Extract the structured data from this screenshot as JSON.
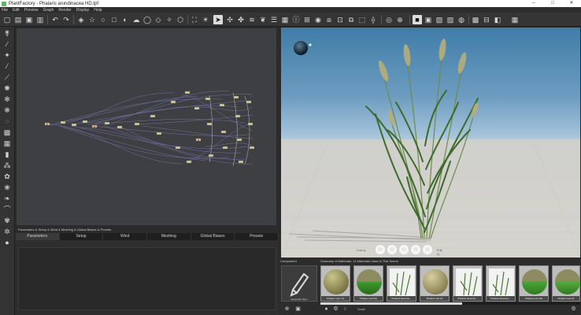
{
  "window": {
    "title": "PlantFactory - Phalaris arundinacea HD.tpf",
    "controls": [
      "─",
      "□",
      "✕"
    ]
  },
  "menu": [
    "File",
    "Edit",
    "Preview",
    "Graph",
    "Render",
    "Display",
    "Help"
  ],
  "toolbar_icons": [
    "new-file-icon",
    "open-file-icon",
    "save-icon",
    "save-as-icon",
    "undo-icon",
    "redo-icon",
    "cube-icon",
    "star-icon",
    "sphere-icon",
    "square-icon",
    "light-icon",
    "cloud-icon",
    "fit-view-icon",
    "sun-icon",
    "select-arrow-icon",
    "node-icon",
    "branch-icon",
    "wind-icon",
    "leaf-icon",
    "info-icon",
    "grid-icon",
    "camera-icon",
    "hide-icon",
    "view-front-icon",
    "render-icon",
    "color-icon",
    "preview-icon",
    "material-icon",
    "chart-icon",
    "palette-icon",
    "grid-layout-icon",
    "window-icon"
  ],
  "left_tool_icons": [
    "tree-icon",
    "stem-icon",
    "leaves-icon",
    "grass-icon",
    "branch-tool-icon",
    "fern-icon",
    "root-icon",
    "flower-icon",
    "sphere-tool-icon",
    "texture-icon",
    "paint-icon",
    "trunk-icon",
    "scatter-icon",
    "bush-icon",
    "brush-icon",
    "cactus-icon",
    "curve-icon",
    "flower-tool-icon",
    "settings-tool-icon",
    "ball-icon"
  ],
  "params": {
    "title": "Parameters & Setup & Wind & Meshing & Global Biases & Presets",
    "tabs": [
      "Parameters",
      "Setup",
      "Wind",
      "Meshing",
      "Global Biases",
      "Presets"
    ],
    "active_tab": 0
  },
  "viewport": {
    "lod_label": "Low-q",
    "lod_value": "Full Q",
    "stars": [
      "☆",
      "☆",
      "☆",
      "☆",
      "☆"
    ]
  },
  "component": {
    "label": "Component",
    "name": "Automatic Stem"
  },
  "summary": {
    "label": "Summary of Materials: 14 Materials Used In This Scene",
    "materials": [
      {
        "name": "Phalaris stem 01",
        "type": "ball",
        "color": "#8e8a5a"
      },
      {
        "name": "Phalaris leaf 01a",
        "type": "ball",
        "color": "#3f8f2f"
      },
      {
        "name": "Phalaris flowerhe...",
        "type": "leaf",
        "color": "#5a8a3a"
      },
      {
        "name": "Phalaris leaf 02",
        "type": "ball",
        "color": "#9b8f60"
      },
      {
        "name": "Phalaris flowerhe...",
        "type": "leaf",
        "color": "#5a8a3a"
      },
      {
        "name": "Phalaris flowerhe...",
        "type": "leaf",
        "color": "#5a8a3a"
      },
      {
        "name": "Phalaris leaf 03a",
        "type": "ball",
        "color": "#4a9a32"
      },
      {
        "name": "Phalaris leaf 04",
        "type": "ball",
        "color": "#5c9a3a"
      }
    ]
  },
  "bottom_bar": {
    "scale_label": "Scale",
    "icons": [
      "add-icon",
      "material-edit-icon",
      "circle-icon",
      "settings-icon"
    ]
  }
}
